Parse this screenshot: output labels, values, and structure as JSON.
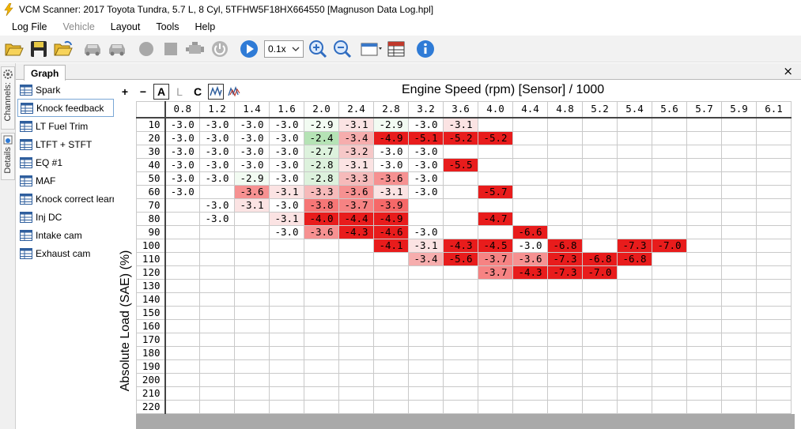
{
  "window": {
    "title": "VCM Scanner: 2017 Toyota Tundra, 5.7 L, 8 Cyl, 5TFHW5F18HX664550 [Magnuson Data Log.hpl]"
  },
  "menu": [
    {
      "label": "Log File",
      "disabled": false
    },
    {
      "label": "Vehicle",
      "disabled": true
    },
    {
      "label": "Layout",
      "disabled": false
    },
    {
      "label": "Tools",
      "disabled": false
    },
    {
      "label": "Help",
      "disabled": false
    }
  ],
  "toolbar": {
    "speed": "0.1x",
    "icons": [
      "open-folder-icon",
      "save-icon",
      "open-recent-icon",
      "vehicle-icon",
      "vehicle-icon-2",
      "record-icon",
      "stop-icon",
      "engine-icon",
      "power-icon",
      "play-icon",
      "zoom-in-icon",
      "zoom-out-icon",
      "layout-icon",
      "table-icon",
      "info-icon"
    ]
  },
  "side_tabs": {
    "channels": "Channels:",
    "details": "Details"
  },
  "tabs": {
    "graph": "Graph",
    "close": "×"
  },
  "channels": [
    {
      "label": "Spark",
      "selected": false
    },
    {
      "label": "Knock feedback",
      "selected": true
    },
    {
      "label": "LT Fuel Trim",
      "selected": false
    },
    {
      "label": "LTFT + STFT",
      "selected": false
    },
    {
      "label": "EQ #1",
      "selected": false
    },
    {
      "label": "MAF",
      "selected": false
    },
    {
      "label": "Knock correct learn",
      "selected": false
    },
    {
      "label": "Inj DC",
      "selected": false
    },
    {
      "label": "Intake cam",
      "selected": false
    },
    {
      "label": "Exhaust cam",
      "selected": false
    }
  ],
  "graph_toolbar": {
    "plus": "+",
    "minus": "−",
    "a": "A",
    "l": "L",
    "c": "C"
  },
  "table": {
    "x_title": "Engine Speed (rpm) [Sensor] / 1000",
    "y_title": "Absolute Load (SAE) (%)",
    "columns": [
      "0.8",
      "1.2",
      "1.4",
      "1.6",
      "2.0",
      "2.4",
      "2.8",
      "3.2",
      "3.6",
      "4.0",
      "4.4",
      "4.8",
      "5.2",
      "5.4",
      "5.6",
      "5.7",
      "5.9",
      "6.1"
    ],
    "rows": [
      {
        "label": "10",
        "cells": [
          "-3.0",
          "-3.0",
          "-3.0",
          "-3.0",
          "-2.9",
          "-3.1",
          "-2.9",
          "-3.0",
          "-3.1",
          "",
          "",
          "",
          "",
          "",
          "",
          "",
          "",
          ""
        ]
      },
      {
        "label": "20",
        "cells": [
          "-3.0",
          "-3.0",
          "-3.0",
          "-3.0",
          "-2.4",
          "-3.4",
          "-4.9",
          "-5.1",
          "-5.2",
          "-5.2",
          "",
          "",
          "",
          "",
          "",
          "",
          "",
          ""
        ]
      },
      {
        "label": "30",
        "cells": [
          "-3.0",
          "-3.0",
          "-3.0",
          "-3.0",
          "-2.7",
          "-3.2",
          "-3.0",
          "-3.0",
          "",
          "",
          "",
          "",
          "",
          "",
          "",
          "",
          "",
          ""
        ]
      },
      {
        "label": "40",
        "cells": [
          "-3.0",
          "-3.0",
          "-3.0",
          "-3.0",
          "-2.8",
          "-3.1",
          "-3.0",
          "-3.0",
          "-5.5",
          "",
          "",
          "",
          "",
          "",
          "",
          "",
          "",
          ""
        ]
      },
      {
        "label": "50",
        "cells": [
          "-3.0",
          "-3.0",
          "-2.9",
          "-3.0",
          "-2.8",
          "-3.3",
          "-3.6",
          "-3.0",
          "",
          "",
          "",
          "",
          "",
          "",
          "",
          "",
          "",
          ""
        ]
      },
      {
        "label": "60",
        "cells": [
          "-3.0",
          "",
          "-3.6",
          "-3.1",
          "-3.3",
          "-3.6",
          "-3.1",
          "-3.0",
          "",
          "-5.7",
          "",
          "",
          "",
          "",
          "",
          "",
          "",
          ""
        ]
      },
      {
        "label": "70",
        "cells": [
          "",
          "-3.0",
          "-3.1",
          "-3.0",
          "-3.8",
          "-3.7",
          "-3.9",
          "",
          "",
          "",
          "",
          "",
          "",
          "",
          "",
          "",
          "",
          ""
        ]
      },
      {
        "label": "80",
        "cells": [
          "",
          "-3.0",
          "",
          "-3.1",
          "-4.0",
          "-4.4",
          "-4.9",
          "",
          "",
          "-4.7",
          "",
          "",
          "",
          "",
          "",
          "",
          "",
          ""
        ]
      },
      {
        "label": "90",
        "cells": [
          "",
          "",
          "",
          "-3.0",
          "-3.6",
          "-4.3",
          "-4.6",
          "-3.0",
          "",
          "",
          "-6.6",
          "",
          "",
          "",
          "",
          "",
          "",
          ""
        ]
      },
      {
        "label": "100",
        "cells": [
          "",
          "",
          "",
          "",
          "",
          "",
          "-4.1",
          "-3.1",
          "-4.3",
          "-4.5",
          "-3.0",
          "-6.8",
          "",
          "-7.3",
          "-7.0",
          "",
          "",
          ""
        ]
      },
      {
        "label": "110",
        "cells": [
          "",
          "",
          "",
          "",
          "",
          "",
          "",
          "-3.4",
          "-5.6",
          "-3.7",
          "-3.6",
          "-7.3",
          "-6.8",
          "-6.8",
          "",
          "",
          "",
          ""
        ]
      },
      {
        "label": "120",
        "cells": [
          "",
          "",
          "",
          "",
          "",
          "",
          "",
          "",
          "",
          "-3.7",
          "-4.3",
          "-7.3",
          "-7.0",
          "",
          "",
          "",
          "",
          ""
        ]
      },
      {
        "label": "130",
        "cells": [
          "",
          "",
          "",
          "",
          "",
          "",
          "",
          "",
          "",
          "",
          "",
          "",
          "",
          "",
          "",
          "",
          "",
          ""
        ]
      },
      {
        "label": "140",
        "cells": [
          "",
          "",
          "",
          "",
          "",
          "",
          "",
          "",
          "",
          "",
          "",
          "",
          "",
          "",
          "",
          "",
          "",
          ""
        ]
      },
      {
        "label": "150",
        "cells": [
          "",
          "",
          "",
          "",
          "",
          "",
          "",
          "",
          "",
          "",
          "",
          "",
          "",
          "",
          "",
          "",
          "",
          ""
        ]
      },
      {
        "label": "160",
        "cells": [
          "",
          "",
          "",
          "",
          "",
          "",
          "",
          "",
          "",
          "",
          "",
          "",
          "",
          "",
          "",
          "",
          "",
          ""
        ]
      },
      {
        "label": "170",
        "cells": [
          "",
          "",
          "",
          "",
          "",
          "",
          "",
          "",
          "",
          "",
          "",
          "",
          "",
          "",
          "",
          "",
          "",
          ""
        ]
      },
      {
        "label": "180",
        "cells": [
          "",
          "",
          "",
          "",
          "",
          "",
          "",
          "",
          "",
          "",
          "",
          "",
          "",
          "",
          "",
          "",
          "",
          ""
        ]
      },
      {
        "label": "190",
        "cells": [
          "",
          "",
          "",
          "",
          "",
          "",
          "",
          "",
          "",
          "",
          "",
          "",
          "",
          "",
          "",
          "",
          "",
          ""
        ]
      },
      {
        "label": "200",
        "cells": [
          "",
          "",
          "",
          "",
          "",
          "",
          "",
          "",
          "",
          "",
          "",
          "",
          "",
          "",
          "",
          "",
          "",
          ""
        ]
      },
      {
        "label": "210",
        "cells": [
          "",
          "",
          "",
          "",
          "",
          "",
          "",
          "",
          "",
          "",
          "",
          "",
          "",
          "",
          "",
          "",
          "",
          ""
        ]
      },
      {
        "label": "220",
        "cells": [
          "",
          "",
          "",
          "",
          "",
          "",
          "",
          "",
          "",
          "",
          "",
          "",
          "",
          "",
          "",
          "",
          "",
          ""
        ]
      }
    ]
  }
}
